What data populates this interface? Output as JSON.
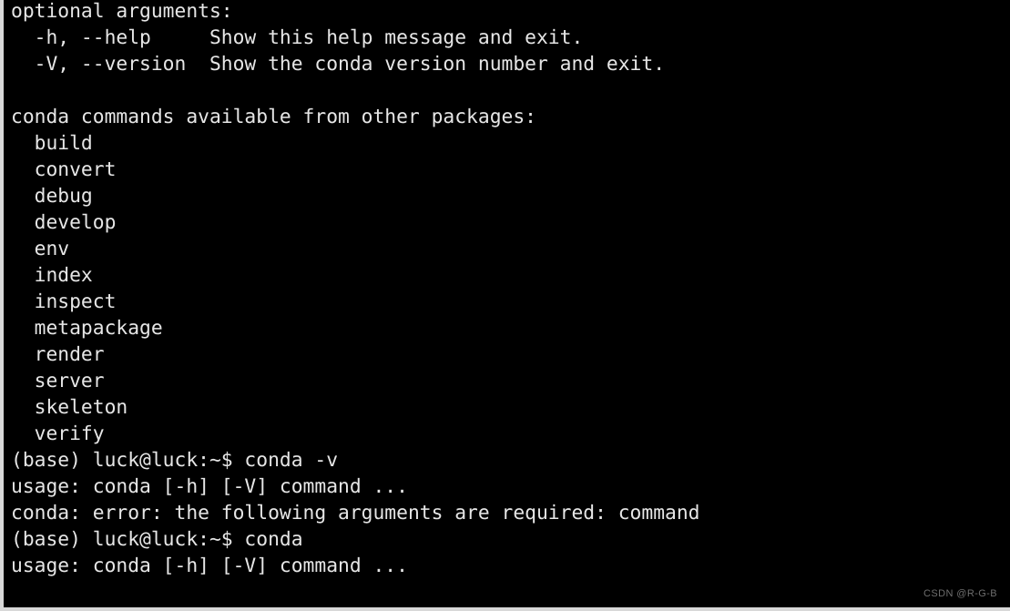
{
  "terminal": {
    "background_color": "#000000",
    "foreground_color": "#e6e6e6",
    "border_color": "#d8d8d8",
    "lines": [
      "optional arguments:",
      "  -h, --help     Show this help message and exit.",
      "  -V, --version  Show the conda version number and exit.",
      "",
      "conda commands available from other packages:",
      "  build",
      "  convert",
      "  debug",
      "  develop",
      "  env",
      "  index",
      "  inspect",
      "  metapackage",
      "  render",
      "  server",
      "  skeleton",
      "  verify",
      "(base) luck@luck:~$ conda -v",
      "usage: conda [-h] [-V] command ...",
      "conda: error: the following arguments are required: command",
      "(base) luck@luck:~$ conda",
      "usage: conda [-h] [-V] command ..."
    ],
    "section_headers": {
      "optional_arguments": "optional arguments:",
      "other_packages": "conda commands available from other packages:"
    },
    "optional_argument_rows": [
      {
        "flags": "-h, --help",
        "description": "Show this help message and exit."
      },
      {
        "flags": "-V, --version",
        "description": "Show the conda version number and exit."
      }
    ],
    "package_commands": [
      "build",
      "convert",
      "debug",
      "develop",
      "env",
      "index",
      "inspect",
      "metapackage",
      "render",
      "server",
      "skeleton",
      "verify"
    ],
    "shell_entries": [
      {
        "prompt": "(base) luck@luck:~$",
        "command": "conda -v",
        "full_line": "(base) luck@luck:~$ conda -v",
        "output": [
          "usage: conda [-h] [-V] command ...",
          "conda: error: the following arguments are required: command"
        ]
      },
      {
        "prompt": "(base) luck@luck:~$",
        "command": "conda",
        "full_line": "(base) luck@luck:~$ conda",
        "output": [
          "usage: conda [-h] [-V] command ..."
        ]
      }
    ],
    "prompt_user": "luck",
    "prompt_host": "luck",
    "prompt_path": "~",
    "prompt_env": "(base)",
    "prompt_symbol": "$"
  },
  "watermark": {
    "text": "CSDN @R-G-B",
    "color": "#6e6e6e"
  }
}
